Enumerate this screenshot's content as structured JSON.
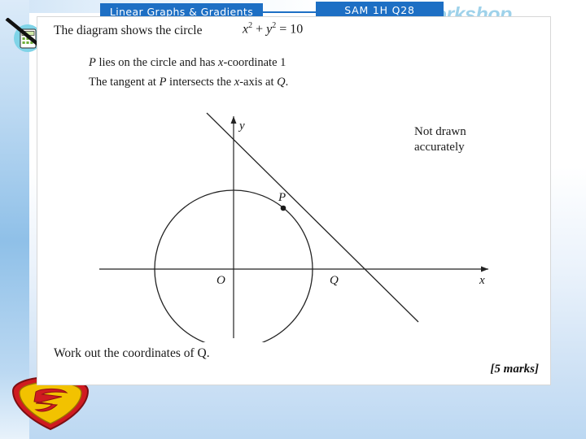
{
  "slide": {
    "topic_banner": "Linear Graphs & Gradients",
    "reference_banner": "SAM 1H Q28",
    "watermark": "@westiesworkshop"
  },
  "icons": {
    "calculator": "no-calculator-icon",
    "badge": "superman-badge-icon"
  },
  "question": {
    "line1": "The diagram shows the circle",
    "equation_plain": "x2 + y2 = 10",
    "equation": {
      "x": "x",
      "x_power": "2",
      "plus": " + ",
      "y": "y",
      "y_power": "2",
      "equals": " = 10"
    },
    "line2_a": "P",
    "line2_b": " lies on the circle and has ",
    "line2_c": "x",
    "line2_d": "-coordinate 1",
    "line3_a": "The tangent at ",
    "line3_b": "P",
    "line3_c": " intersects the ",
    "line3_d": "x",
    "line3_e": "-axis at ",
    "line3_f": "Q",
    "line3_g": ".",
    "note_line1": "Not drawn",
    "note_line2": "accurately",
    "line4": "Work out the coordinates of Q.",
    "marks": "[5 marks]"
  },
  "diagram": {
    "axis_y_label": "y",
    "axis_x_label": "x",
    "point_P": "P",
    "point_O": "O",
    "point_Q": "Q",
    "circle": {
      "center": [
        0,
        0
      ],
      "radius_equation": "x^2 + y^2 = 10"
    }
  }
}
